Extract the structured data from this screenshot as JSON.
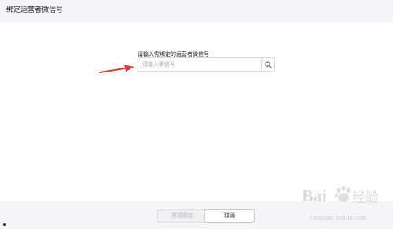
{
  "dialog": {
    "title": "绑定运营者微信号",
    "field_label": "请输入需绑定的运营者微信号",
    "search": {
      "placeholder": "请输入微信号",
      "value": "",
      "icon": "search-icon"
    },
    "buttons": {
      "confirm_label": "邀请绑定",
      "cancel_label": "取消"
    },
    "annotation_arrow_color": "#e33a2f"
  },
  "watermark": {
    "brand": "Bai 经验",
    "url": "jingyan.baidu.com"
  }
}
